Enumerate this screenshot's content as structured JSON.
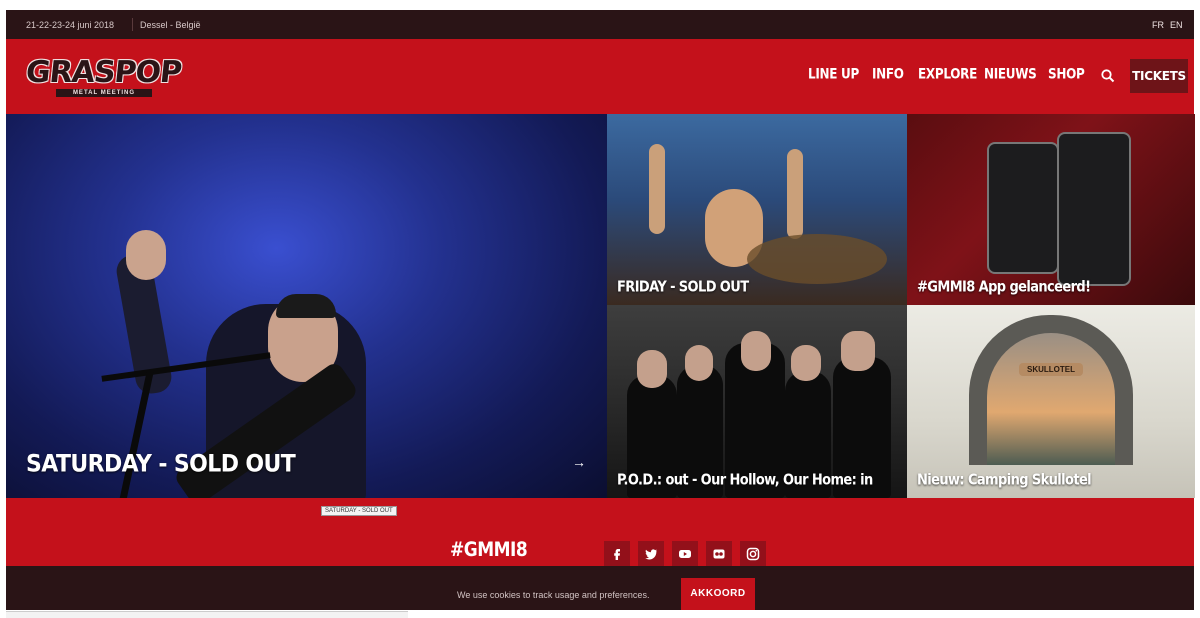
{
  "topbar": {
    "date": "21-22-23-24 juni 2018",
    "location": "Dessel - België",
    "lang_fr": "FR",
    "lang_en": "EN"
  },
  "logo": {
    "word": "GRASPOP",
    "sub": "METAL MEETING"
  },
  "nav": {
    "items": [
      "LINE UP",
      "INFO",
      "EXPLORE",
      "NIEUWS",
      "SHOP"
    ],
    "tickets": "TICKETS",
    "search_icon": "search-icon"
  },
  "tiles": {
    "hero": "SATURDAY - SOLD OUT",
    "friday": "FRIDAY - SOLD OUT",
    "app": "#GMMI8 App gelanceerd!",
    "pod": "P.O.D.: out - Our Hollow, Our Home: in",
    "camping": "Nieuw: Camping Skullotel",
    "skullotel_sign": "SKULLOTEL"
  },
  "tooltip": "SATURDAY - SOLD OUT",
  "footer": {
    "hashtag": "#GMMI8",
    "social": [
      "facebook-icon",
      "twitter-icon",
      "youtube-icon",
      "flickr-icon",
      "instagram-icon"
    ]
  },
  "cookie": {
    "message": "We use cookies to track usage and preferences.",
    "button": "AKKOORD"
  },
  "colors": {
    "brand_red": "#c4111b",
    "dark": "#2a1416",
    "button_dark_red": "#6e1418"
  }
}
